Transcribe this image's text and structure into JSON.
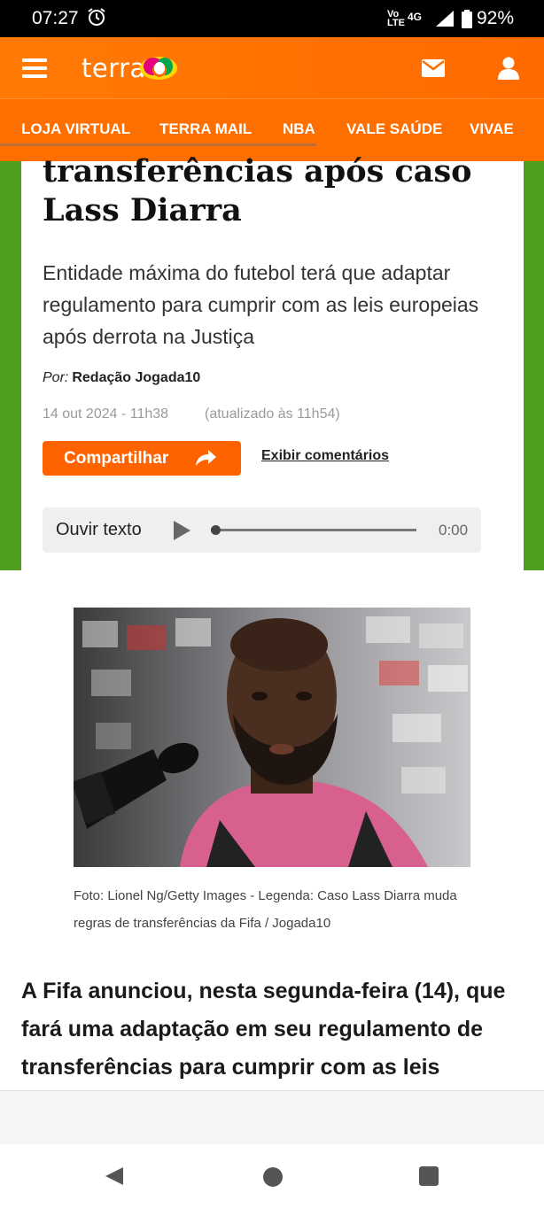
{
  "status_bar": {
    "time": "07:27",
    "network_label": "Vo\nLTE",
    "network_type": "4G",
    "battery": "92%"
  },
  "header": {
    "logo": "terra",
    "colors": {
      "brand_orange": "#ff6f00",
      "accent_green": "#4f9e1f"
    }
  },
  "nav": {
    "items": [
      {
        "label": "LOJA VIRTUAL"
      },
      {
        "label": "TERRA MAIL"
      },
      {
        "label": "NBA"
      },
      {
        "label": "VALE SAÚDE"
      },
      {
        "label": "VIVAE"
      }
    ]
  },
  "article": {
    "title": "transferências após caso Lass Diarra",
    "subtitle": "Entidade máxima do futebol terá que adaptar regulamento para cumprir com as leis europeias após derrota na Justiça",
    "byline_prefix": "Por:",
    "author": "Redação Jogada10",
    "date": "14 out 2024 - 11h38",
    "updated": "(atualizado às 11h54)",
    "share_label": "Compartilhar",
    "comments_label": "Exibir comentários",
    "player": {
      "label": "Ouvir texto",
      "time": "0:00",
      "progress": 0
    },
    "photo_caption": "Foto: Lionel Ng/Getty Images - Legenda: Caso Lass Diarra muda regras de transferências da Fifa / Jogada10",
    "body": "A Fifa anunciou, nesta segunda-feira (14), que fará uma adaptação em seu regulamento de transferências para cumprir com as leis"
  }
}
